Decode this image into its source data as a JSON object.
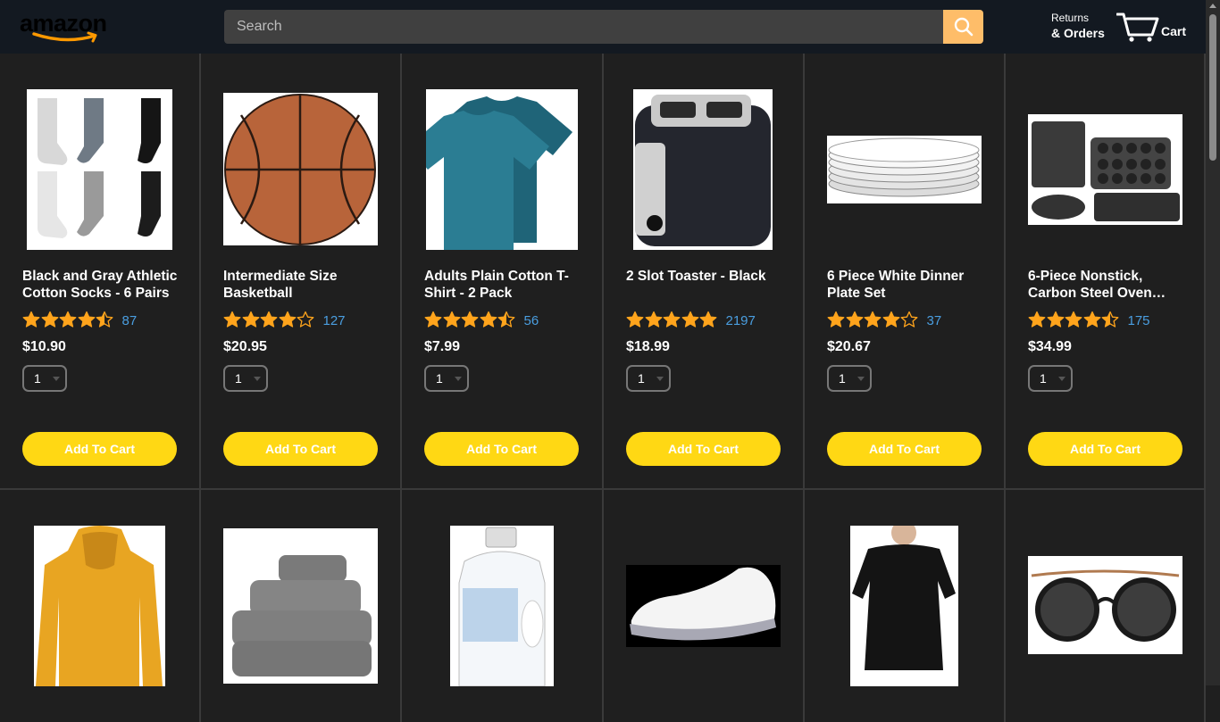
{
  "header": {
    "logo_text": "amazon",
    "search_placeholder": "Search",
    "returns_top": "Returns",
    "returns_bottom": "& Orders",
    "cart_label": "Cart"
  },
  "colors": {
    "header_bg": "#131921",
    "page_bg": "#1f1f1f",
    "search_button": "#febd69",
    "add_button": "#ffd814",
    "star": "#ffa41c",
    "rating_count": "#4a9ee0"
  },
  "add_to_cart_label": "Add To Cart",
  "products": [
    {
      "name": "Black and Gray Athletic Cotton Socks - 6 Pairs",
      "rating": 4.5,
      "count": "87",
      "price": "$10.90",
      "qty": "1",
      "image": "socks-image"
    },
    {
      "name": "Intermediate Size Basketball",
      "rating": 4.0,
      "count": "127",
      "price": "$20.95",
      "qty": "1",
      "image": "basketball-image"
    },
    {
      "name": "Adults Plain Cotton T-Shirt - 2 Pack",
      "rating": 4.5,
      "count": "56",
      "price": "$7.99",
      "qty": "1",
      "image": "tshirt-image"
    },
    {
      "name": "2 Slot Toaster - Black",
      "rating": 5.0,
      "count": "2197",
      "price": "$18.99",
      "qty": "1",
      "image": "toaster-image"
    },
    {
      "name": "6 Piece White Dinner Plate Set",
      "rating": 4.0,
      "count": "37",
      "price": "$20.67",
      "qty": "1",
      "image": "plates-image"
    },
    {
      "name": "6-Piece Nonstick, Carbon Steel Oven…",
      "rating": 4.5,
      "count": "175",
      "price": "$34.99",
      "qty": "1",
      "image": "bakeware-image"
    }
  ],
  "row2_images": [
    "hoodie-image",
    "towels-image",
    "detergent-image",
    "sneaker-image",
    "cover-up-dress-image",
    "sunglasses-image"
  ]
}
